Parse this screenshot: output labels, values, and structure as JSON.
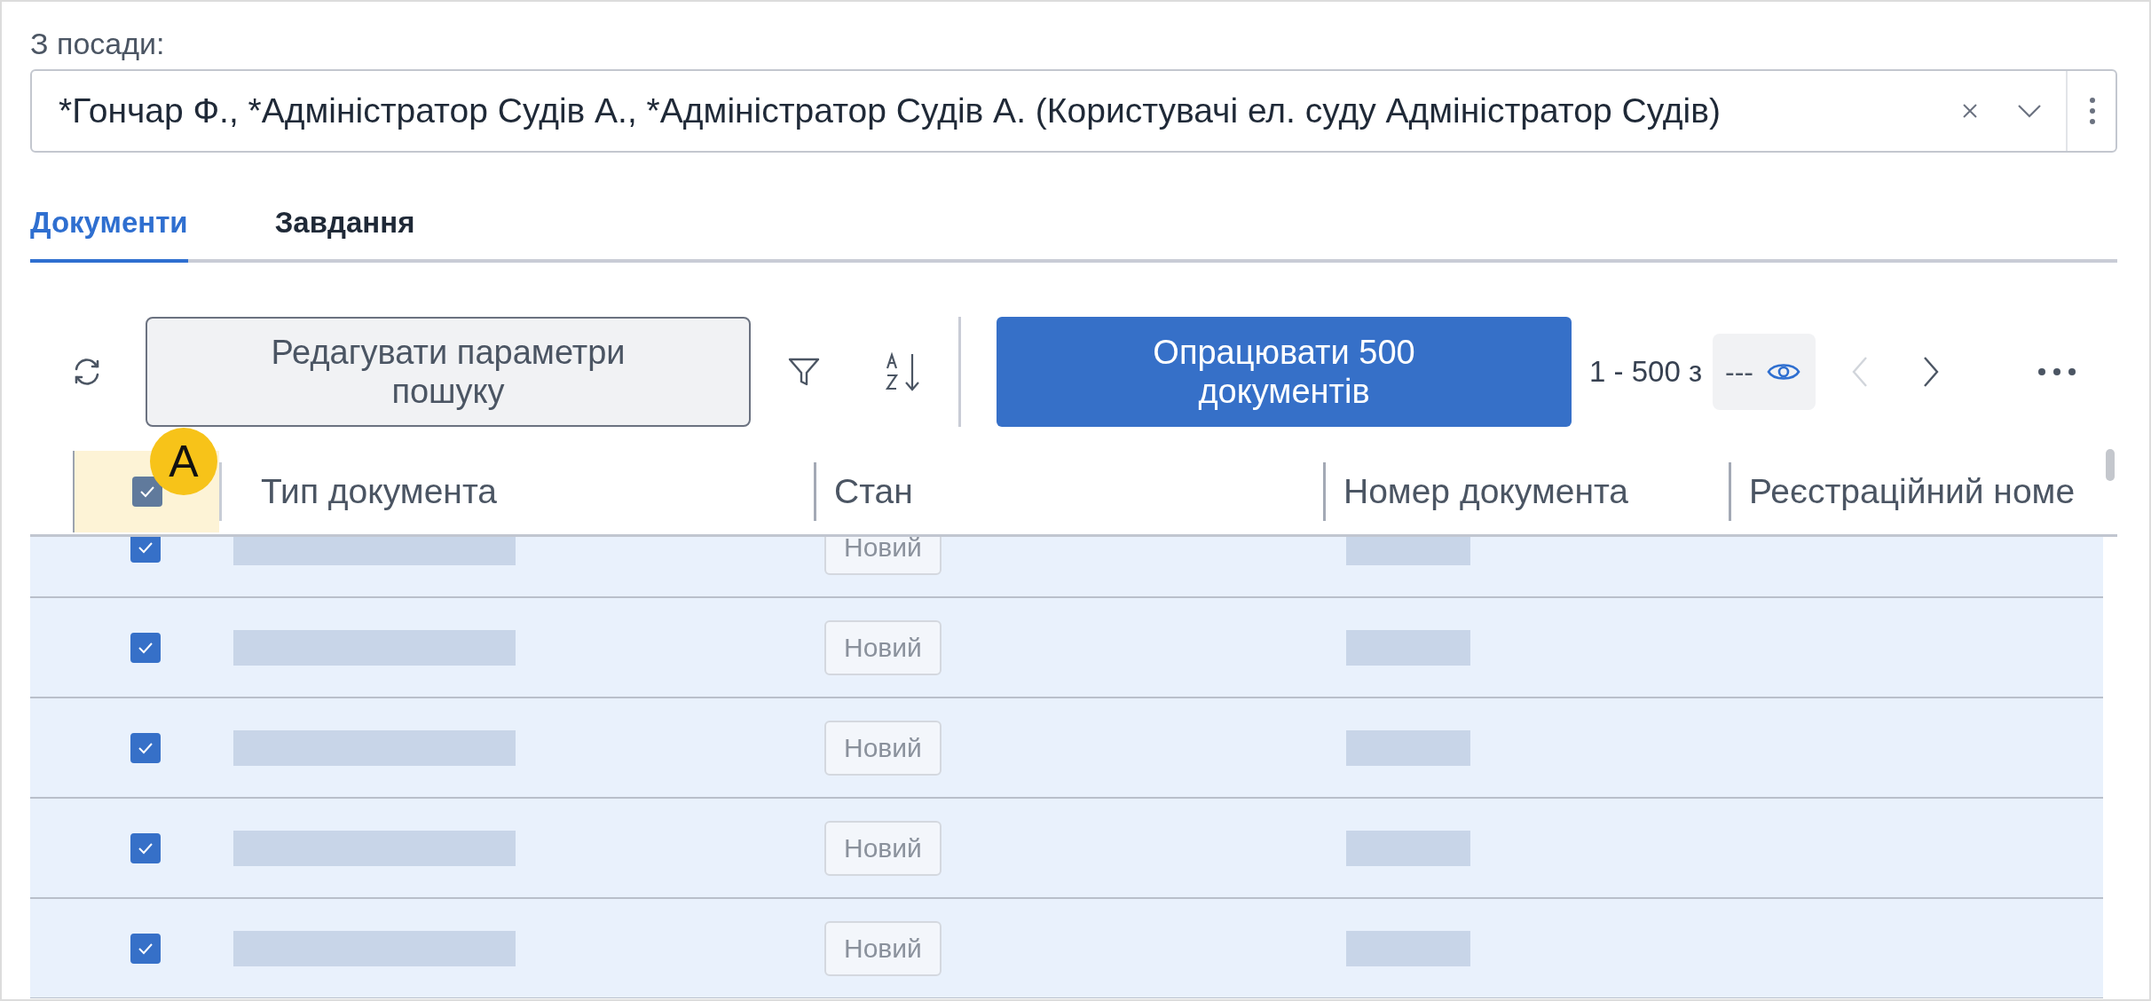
{
  "position_field": {
    "label": "З посади:",
    "value": "*Гончар Ф., *Адміністратор Судів А., *Адміністратор Судів А. (Користувачі ел. суду Адміністратор Судів)"
  },
  "tabs": [
    {
      "label": "Документи",
      "selected": true
    },
    {
      "label": "Завдання",
      "selected": false
    }
  ],
  "toolbar": {
    "edit_button": "Редагувати параметри пошуку",
    "process_button": "Опрацювати 500 документів",
    "range": "1 - 500 з",
    "total": "---"
  },
  "annotation_marker": "A",
  "table": {
    "select_all_checked": true,
    "columns": [
      "Тип документа",
      "Стан",
      "Номер документа",
      "Реєстраційний номе"
    ],
    "rows": [
      {
        "checked": true,
        "status": "Новий"
      },
      {
        "checked": true,
        "status": "Новий"
      },
      {
        "checked": true,
        "status": "Новий"
      },
      {
        "checked": true,
        "status": "Новий"
      },
      {
        "checked": true,
        "status": "Новий"
      }
    ]
  }
}
